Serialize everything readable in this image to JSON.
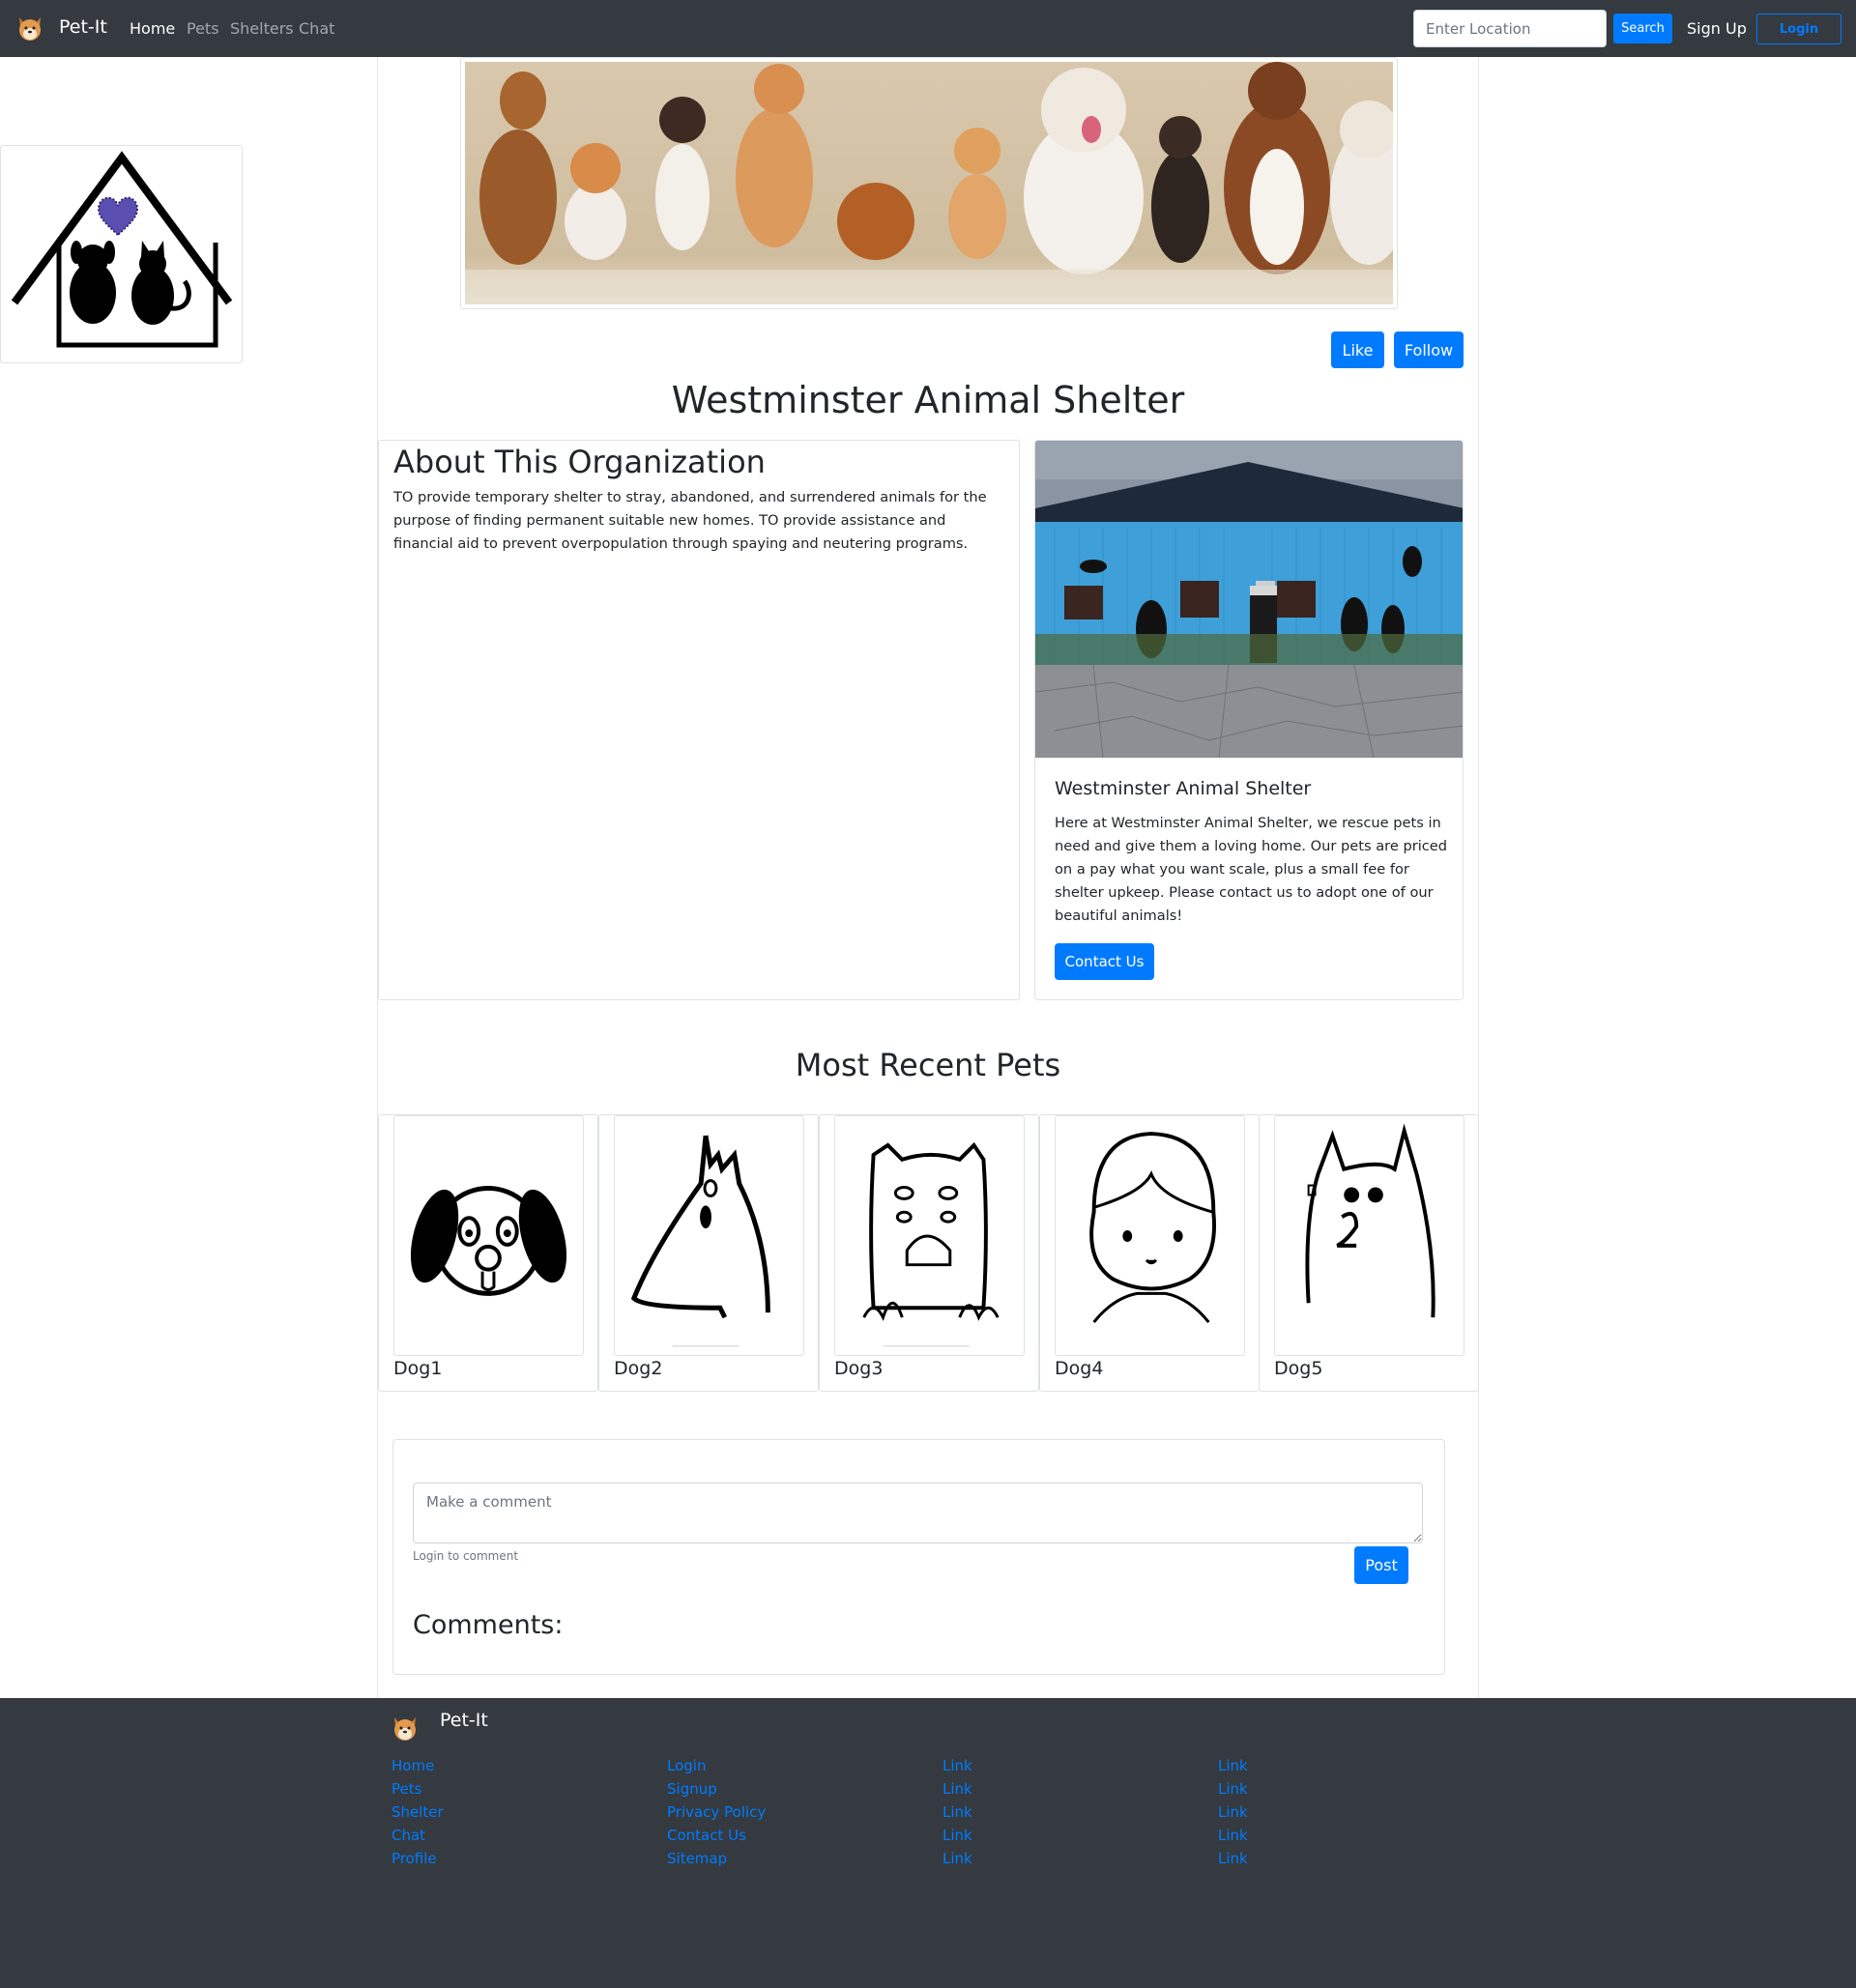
{
  "nav": {
    "brand": "Pet-It",
    "links": [
      "Home",
      "Pets",
      "Shelters",
      "Chat"
    ],
    "location_placeholder": "Enter Location",
    "search_label": "Search",
    "signup_label": "Sign Up",
    "login_label": "Login"
  },
  "actions": {
    "like_label": "Like",
    "follow_label": "Follow"
  },
  "shelter": {
    "title": "Westminster Animal Shelter"
  },
  "about": {
    "heading": "About This Organization",
    "text": "TO provide temporary shelter to stray, abandoned, and surrendered animals for the purpose of finding permanent suitable new homes. TO provide assistance and financial aid to prevent overpopulation through spaying and neutering programs."
  },
  "org_card": {
    "name": "Westminster Animal Shelter",
    "text": "Here at Westminster Animal Shelter, we rescue pets in need and give them a loving home. Our pets are priced on a pay what you want scale, plus a small fee for shelter upkeep. Please contact us to adopt one of our beautiful animals!",
    "contact_label": "Contact Us"
  },
  "recent": {
    "heading": "Most Recent Pets",
    "pets": [
      {
        "name": "Dog1"
      },
      {
        "name": "Dog2"
      },
      {
        "name": "Dog3"
      },
      {
        "name": "Dog4"
      },
      {
        "name": "Dog5"
      }
    ]
  },
  "comments": {
    "placeholder": "Make a comment",
    "login_hint": "Login to comment",
    "post_label": "Post",
    "heading": "Comments:"
  },
  "footer": {
    "brand": "Pet-It",
    "columns": [
      [
        "Home",
        "Pets",
        "Shelter",
        "Chat",
        "Profile"
      ],
      [
        "Login",
        "Signup",
        "Privacy Policy",
        "Contact Us",
        "Sitemap"
      ],
      [
        "Link",
        "Link",
        "Link",
        "Link",
        "Link"
      ],
      [
        "Link",
        "Link",
        "Link",
        "Link",
        "Link"
      ]
    ]
  },
  "colors": {
    "navbar": "#343a40",
    "primary": "#007bff",
    "border": "#dee2e6"
  },
  "icons": [
    "shiba-logo-icon",
    "shelter-house-logo",
    "search-icon"
  ]
}
